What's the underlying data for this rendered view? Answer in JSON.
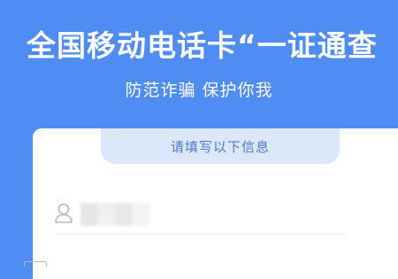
{
  "header": {
    "title": "全国移动电话卡“一证通查",
    "subtitle": "防范诈骗 保护你我"
  },
  "form": {
    "tab_label": "请填写以下信息",
    "name_field": {
      "icon": "user-icon",
      "value": ""
    },
    "next_field": {
      "icon": "id-card-icon"
    }
  },
  "colors": {
    "background": "#4f8df5",
    "tab": "#dce8fa",
    "tab_text": "#4a79d6"
  }
}
